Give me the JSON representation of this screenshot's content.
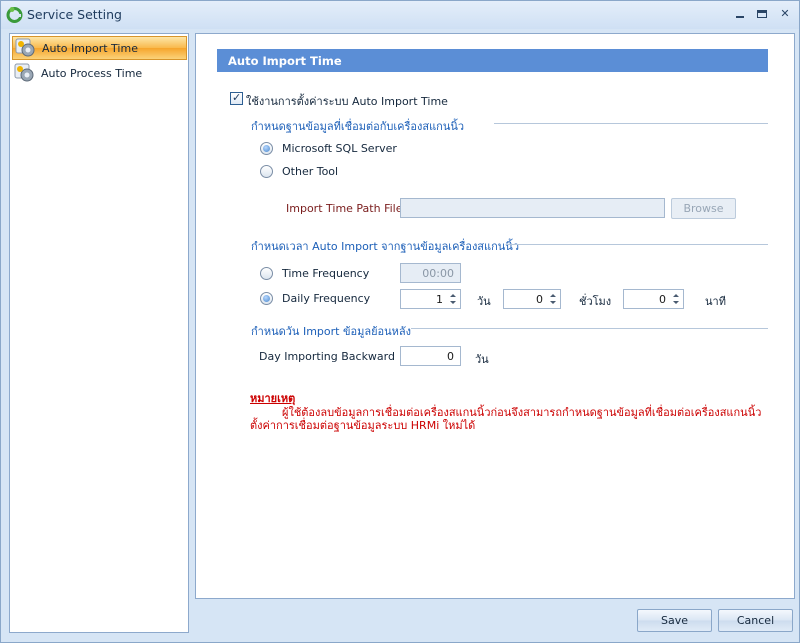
{
  "window": {
    "title": "Service Setting"
  },
  "sidebar": {
    "items": [
      {
        "label": "Auto Import Time",
        "active": true
      },
      {
        "label": "Auto Process Time",
        "active": false
      }
    ]
  },
  "main": {
    "header": "Auto Import Time",
    "enable_checkbox": {
      "label": "ใช้งานการตั้งค่าระบบ Auto Import Time",
      "checked": true
    },
    "group_db": {
      "title": "กำหนดฐานข้อมูลที่เชื่อมต่อกับเครื่องสแกนนิ้ว",
      "radio_sql": {
        "label": "Microsoft SQL Server",
        "selected": true
      },
      "radio_other": {
        "label": "Other Tool",
        "selected": false
      },
      "path_label": "Import Time Path File",
      "path_value": "",
      "browse_label": "Browse"
    },
    "group_time": {
      "title": "กำหนดเวลา Auto Import จากฐานข้อมูลเครื่องสแกนนิ้ว",
      "radio_time_freq": {
        "label": "Time Frequency",
        "selected": false
      },
      "time_freq_value": "00:00",
      "radio_daily_freq": {
        "label": "Daily Frequency",
        "selected": true
      },
      "days_value": "1",
      "days_unit": "วัน",
      "hours_value": "0",
      "hours_unit": "ชั่วโมง",
      "minutes_value": "0",
      "minutes_unit": "นาที"
    },
    "group_backward": {
      "title": "กำหนดวัน Import ข้อมูลย้อนหลัง",
      "label": "Day Importing Backward",
      "value": "0",
      "unit": "วัน"
    },
    "note": {
      "title": "หมายเหตุ",
      "line1": "ผู้ใช้ต้องลบข้อมูลการเชื่อมต่อเครื่องสแกนนิ้วก่อนจึงสามารถกำหนดฐานข้อมูลที่เชื่อมต่อเครื่องสแกนนิ้ว",
      "line2": "ตั้งค่าการเชื่อมต่อฐานข้อมูลระบบ HRMi ใหม่ได้"
    }
  },
  "footer": {
    "save_label": "Save",
    "cancel_label": "Cancel"
  },
  "colors": {
    "header_bg": "#5b8ed6",
    "group_title": "#1c5fb8",
    "note": "#cc0000",
    "active_item": "#f9b94c"
  }
}
